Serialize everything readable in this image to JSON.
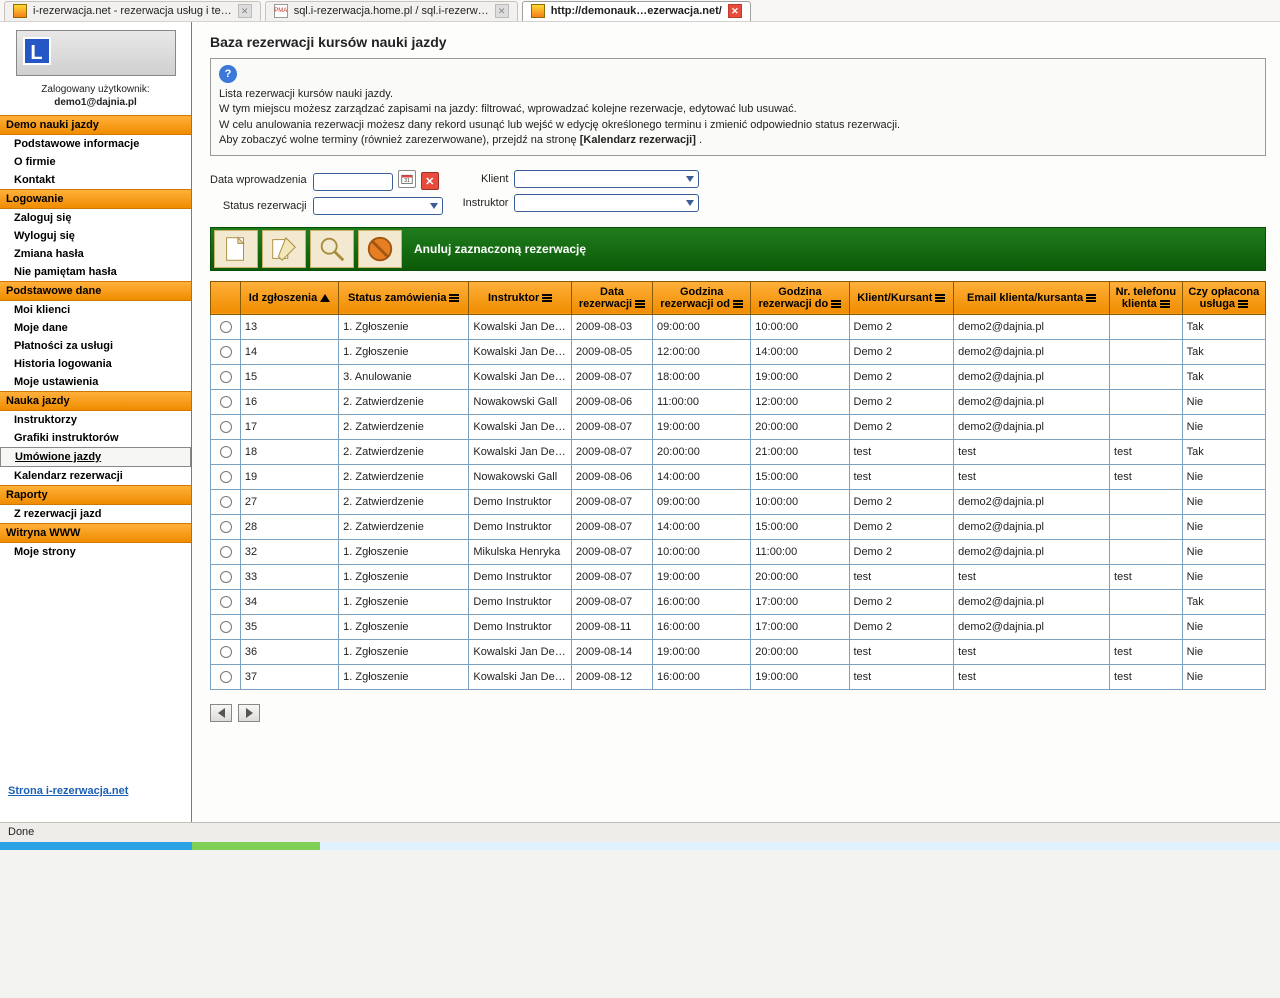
{
  "tabs": [
    {
      "label": "i-rezerwacja.net - rezerwacja usług i te…",
      "active": false,
      "kind": "yi"
    },
    {
      "label": "sql.i-rezerwacja.home.pl / sql.i-rezerw…",
      "active": false,
      "kind": "pma"
    },
    {
      "label": "http://demonauk…ezerwacja.net/",
      "active": true,
      "kind": "yi"
    }
  ],
  "user": {
    "line1": "Zalogowany użytkownik:",
    "line2": "demo1@dajnia.pl"
  },
  "sidebar": {
    "groups": [
      {
        "head": "Demo nauki jazdy",
        "items": [
          {
            "label": "Podstawowe informacje",
            "bold": true
          },
          {
            "label": "O firmie",
            "bold": true
          },
          {
            "label": "Kontakt",
            "bold": true
          }
        ]
      },
      {
        "head": "Logowanie",
        "items": [
          {
            "label": "Zaloguj się",
            "bold": true
          },
          {
            "label": "Wyloguj się",
            "bold": true
          },
          {
            "label": "Zmiana hasła",
            "bold": true
          },
          {
            "label": "Nie pamiętam hasła",
            "bold": true
          }
        ]
      },
      {
        "head": "Podstawowe dane",
        "items": [
          {
            "label": "Moi klienci",
            "bold": true
          },
          {
            "label": "Moje dane",
            "bold": true
          },
          {
            "label": "Płatności za usługi",
            "bold": true
          },
          {
            "label": "Historia logowania",
            "bold": true
          },
          {
            "label": "Moje ustawienia",
            "bold": true
          }
        ]
      },
      {
        "head": "Nauka jazdy",
        "items": [
          {
            "label": "Instruktorzy",
            "bold": true
          },
          {
            "label": "Grafiki instruktorów",
            "bold": true
          },
          {
            "label": "Umówione jazdy",
            "bold": true,
            "underline": true,
            "boxed": true
          },
          {
            "label": "Kalendarz rezerwacji",
            "bold": true
          }
        ]
      },
      {
        "head": "Raporty",
        "items": [
          {
            "label": "Z rezerwacji jazd",
            "bold": true
          }
        ]
      },
      {
        "head": "Witryna WWW",
        "items": [
          {
            "label": "Moje strony",
            "bold": true
          }
        ]
      }
    ],
    "bottomlink": "Strona i-rezerwacja.net"
  },
  "page": {
    "title": "Baza rezerwacji kursów nauki jazdy",
    "help_l1": "Lista rezerwacji kursów nauki jazdy.",
    "help_l2": "W tym miejscu możesz zarządzać zapisami na jazdy: filtrować, wprowadzać kolejne rezerwacje, edytować lub usuwać.",
    "help_l3": "W celu anulowania rezerwacji możesz dany rekord usunąć lub wejść w edycję określonego terminu i zmienić odpowiednio status rezerwacji.",
    "help_l4a": "Aby zobaczyć wolne terminy (również zarezerwowane), przejdź na stronę ",
    "help_l4b": "[Kalendarz rezerwacji]",
    "help_l4c": "."
  },
  "filters": {
    "data_wpro_label": "Data wprowadzenia",
    "status_label": "Status rezerwacji",
    "klient_label": "Klient",
    "instruktor_label": "Instruktor"
  },
  "toolbar": {
    "cancel_label": "Anuluj zaznaczoną rezerwację"
  },
  "table": {
    "columns": [
      {
        "label": ""
      },
      {
        "label": "Id zgłoszenia",
        "sort": "asc"
      },
      {
        "label": "Status zamówienia",
        "sort": "menu"
      },
      {
        "label": "Instruktor",
        "sort": "menu"
      },
      {
        "label": "Data rezerwacji",
        "sort": "menu"
      },
      {
        "label": "Godzina rezerwacji od",
        "sort": "menu"
      },
      {
        "label": "Godzina rezerwacji do",
        "sort": "menu"
      },
      {
        "label": "Klient/Kursant",
        "sort": "menu"
      },
      {
        "label": "Email klienta/kursanta",
        "sort": "menu"
      },
      {
        "label": "Nr. telefonu klienta",
        "sort": "menu"
      },
      {
        "label": "Czy opłacona usługa",
        "sort": "menu"
      }
    ],
    "rows": [
      {
        "id": "13",
        "status": "1. Zgłoszenie",
        "instr": "Kowalski Jan Demo",
        "date": "2009-08-03",
        "from": "09:00:00",
        "to": "10:00:00",
        "klient": "Demo 2",
        "email": "demo2@dajnia.pl",
        "phone": "",
        "paid": "Tak"
      },
      {
        "id": "14",
        "status": "1. Zgłoszenie",
        "instr": "Kowalski Jan Demo",
        "date": "2009-08-05",
        "from": "12:00:00",
        "to": "14:00:00",
        "klient": "Demo 2",
        "email": "demo2@dajnia.pl",
        "phone": "",
        "paid": "Tak"
      },
      {
        "id": "15",
        "status": "3. Anulowanie",
        "instr": "Kowalski Jan Demo",
        "date": "2009-08-07",
        "from": "18:00:00",
        "to": "19:00:00",
        "klient": "Demo 2",
        "email": "demo2@dajnia.pl",
        "phone": "",
        "paid": "Tak"
      },
      {
        "id": "16",
        "status": "2. Zatwierdzenie",
        "instr": "Nowakowski Gall",
        "date": "2009-08-06",
        "from": "11:00:00",
        "to": "12:00:00",
        "klient": "Demo 2",
        "email": "demo2@dajnia.pl",
        "phone": "",
        "paid": "Nie"
      },
      {
        "id": "17",
        "status": "2. Zatwierdzenie",
        "instr": "Kowalski Jan Demo",
        "date": "2009-08-07",
        "from": "19:00:00",
        "to": "20:00:00",
        "klient": "Demo 2",
        "email": "demo2@dajnia.pl",
        "phone": "",
        "paid": "Nie"
      },
      {
        "id": "18",
        "status": "2. Zatwierdzenie",
        "instr": "Kowalski Jan Demo",
        "date": "2009-08-07",
        "from": "20:00:00",
        "to": "21:00:00",
        "klient": "test",
        "email": "test",
        "phone": "test",
        "paid": "Tak"
      },
      {
        "id": "19",
        "status": "2. Zatwierdzenie",
        "instr": "Nowakowski Gall",
        "date": "2009-08-06",
        "from": "14:00:00",
        "to": "15:00:00",
        "klient": "test",
        "email": "test",
        "phone": "test",
        "paid": "Nie"
      },
      {
        "id": "27",
        "status": "2. Zatwierdzenie",
        "instr": "Demo Instruktor",
        "date": "2009-08-07",
        "from": "09:00:00",
        "to": "10:00:00",
        "klient": "Demo 2",
        "email": "demo2@dajnia.pl",
        "phone": "",
        "paid": "Nie"
      },
      {
        "id": "28",
        "status": "2. Zatwierdzenie",
        "instr": "Demo Instruktor",
        "date": "2009-08-07",
        "from": "14:00:00",
        "to": "15:00:00",
        "klient": "Demo 2",
        "email": "demo2@dajnia.pl",
        "phone": "",
        "paid": "Nie"
      },
      {
        "id": "32",
        "status": "1. Zgłoszenie",
        "instr": "Mikulska Henryka",
        "date": "2009-08-07",
        "from": "10:00:00",
        "to": "11:00:00",
        "klient": "Demo 2",
        "email": "demo2@dajnia.pl",
        "phone": "",
        "paid": "Nie"
      },
      {
        "id": "33",
        "status": "1. Zgłoszenie",
        "instr": "Demo Instruktor",
        "date": "2009-08-07",
        "from": "19:00:00",
        "to": "20:00:00",
        "klient": "test",
        "email": "test",
        "phone": "test",
        "paid": "Nie"
      },
      {
        "id": "34",
        "status": "1. Zgłoszenie",
        "instr": "Demo Instruktor",
        "date": "2009-08-07",
        "from": "16:00:00",
        "to": "17:00:00",
        "klient": "Demo 2",
        "email": "demo2@dajnia.pl",
        "phone": "",
        "paid": "Tak"
      },
      {
        "id": "35",
        "status": "1. Zgłoszenie",
        "instr": "Demo Instruktor",
        "date": "2009-08-11",
        "from": "16:00:00",
        "to": "17:00:00",
        "klient": "Demo 2",
        "email": "demo2@dajnia.pl",
        "phone": "",
        "paid": "Nie"
      },
      {
        "id": "36",
        "status": "1. Zgłoszenie",
        "instr": "Kowalski Jan Demo",
        "date": "2009-08-14",
        "from": "19:00:00",
        "to": "20:00:00",
        "klient": "test",
        "email": "test",
        "phone": "test",
        "paid": "Nie"
      },
      {
        "id": "37",
        "status": "1. Zgłoszenie",
        "instr": "Kowalski Jan Demo",
        "date": "2009-08-12",
        "from": "16:00:00",
        "to": "19:00:00",
        "klient": "test",
        "email": "test",
        "phone": "test",
        "paid": "Nie"
      }
    ]
  },
  "status": "Done"
}
